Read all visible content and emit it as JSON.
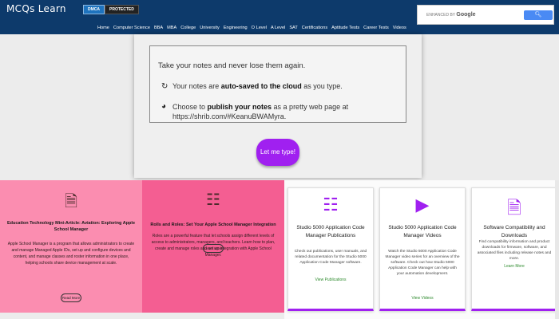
{
  "header": {
    "logo": "MCQs Learn",
    "badge_dmca": "DMCA",
    "badge_protected": "PROTECTED",
    "search": {
      "prefix": "ENHANCED BY",
      "brand": "Google",
      "button_icon": "search-icon"
    },
    "nav": [
      "Home",
      "Computer Science",
      "BBA",
      "MBA",
      "College",
      "University",
      "Engineering",
      "O Level",
      "A Level",
      "SAT",
      "Certifications",
      "Aptitude Tests",
      "Career Tests",
      "Videos"
    ]
  },
  "notes": {
    "title": "Take your notes and never lose them again.",
    "line1_pre": "Your notes are ",
    "line1_bold": "auto-saved to the cloud",
    "line1_post": " as you type.",
    "line2_pre": "Choose to ",
    "line2_bold": "publish your notes",
    "line2_post": " as a pretty web page at",
    "line2_url": "https://shrib.com/#KeanuBWAMyra.",
    "button": "Let me type!"
  },
  "panels": [
    {
      "title": "Education Technology Mini-Article: Aviation: Exploring Apple School Manager",
      "text": "Apple School Manager is a program that allows administrators to create and manage Managed Apple IDs, set up and configure devices and content, and manage classes and roster information in one place, helping schools share device management at scale.",
      "button": "Read More"
    },
    {
      "title": "Rolls and Roles: Set Your Apple School Manager Integration",
      "text": "Roles are a powerful feature that let schools assign different levels of access to administrators, managers, and teachers. Learn how to plan, create and manage roles and set up integration with Apple School Manager.",
      "button": "Learn More"
    }
  ],
  "cards": [
    {
      "title": "Studio 5000 Application Code Manager Publications",
      "text": "Check out publications, user manuals, and related documentation for the Studio 5000 Application Code Manager software.",
      "link": "View Publications"
    },
    {
      "title": "Studio 5000 Application Code Manager Videos",
      "text": "Watch the Studio 5000 Application Code Manager video series for an overview of the software. Check out how Studio 5000 Application Code Manager can help with your automation development.",
      "link": "View Videos"
    },
    {
      "title": "Software Compatibility and Downloads",
      "text": "Find compatibility information and product downloads for firmware, software, and associated files including release notes and more.",
      "link": "Learn More"
    }
  ],
  "colors": {
    "header_bg": "#0d3a6b",
    "accent": "#a020f0",
    "panel1": "#fb8db0",
    "panel2": "#f45e92",
    "link_green": "#2e8b2e"
  }
}
